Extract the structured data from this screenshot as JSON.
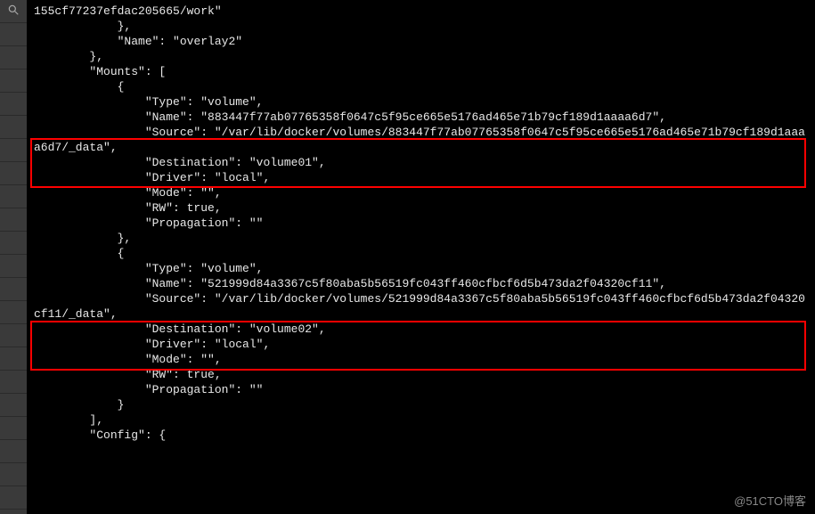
{
  "code": {
    "l1": "155cf77237efdac205665/work\"",
    "l2": "            },",
    "l3": "            \"Name\": \"overlay2\"",
    "l4": "        },",
    "l5": "        \"Mounts\": [",
    "l6": "            {",
    "l7": "                \"Type\": \"volume\",",
    "l8": "                \"Name\": \"883447f77ab07765358f0647c5f95ce665e5176ad465e71b79cf189d1aaaa6d7\",",
    "l9": "                \"Source\": \"/var/lib/docker/volumes/883447f77ab07765358f0647c5f95ce665e5176ad465e71b79cf189d1aaaa6d7/_data\",",
    "l10": "                \"Destination\": \"volume01\",",
    "l11": "                \"Driver\": \"local\",",
    "l12": "                \"Mode\": \"\",",
    "l13": "                \"RW\": true,",
    "l14": "                \"Propagation\": \"\"",
    "l15": "            },",
    "l16": "            {",
    "l17": "                \"Type\": \"volume\",",
    "l18": "                \"Name\": \"521999d84a3367c5f80aba5b56519fc043ff460cfbcf6d5b473da2f04320cf11\",",
    "l19": "                \"Source\": \"/var/lib/docker/volumes/521999d84a3367c5f80aba5b56519fc043ff460cfbcf6d5b473da2f04320cf11/_data\",",
    "l20": "                \"Destination\": \"volume02\",",
    "l21": "                \"Driver\": \"local\",",
    "l22": "                \"Mode\": \"\",",
    "l23": "                \"RW\": true,",
    "l24": "                \"Propagation\": \"\"",
    "l25": "            }",
    "l26": "        ],",
    "l27": "        \"Config\": {"
  },
  "watermark": "@51CTO博客"
}
